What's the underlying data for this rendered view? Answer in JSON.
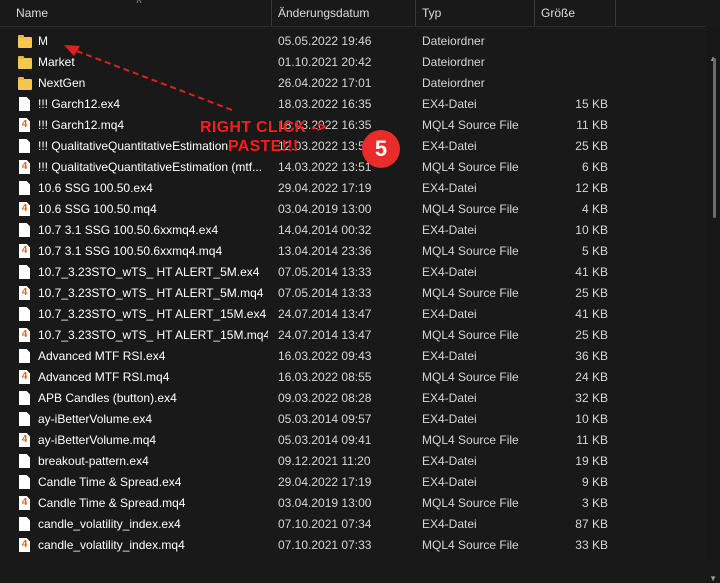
{
  "columns": {
    "name": "Name",
    "date": "Änderungsdatum",
    "type": "Typ",
    "size": "Größe"
  },
  "rows": [
    {
      "name": "M",
      "date": "05.05.2022 19:46",
      "type": "Dateiordner",
      "size": "",
      "icon": "folder"
    },
    {
      "name": "Market",
      "date": "01.10.2021 20:42",
      "type": "Dateiordner",
      "size": "",
      "icon": "folder"
    },
    {
      "name": "NextGen",
      "date": "26.04.2022 17:01",
      "type": "Dateiordner",
      "size": "",
      "icon": "folder"
    },
    {
      "name": "!!! Garch12.ex4",
      "date": "18.03.2022 16:35",
      "type": "EX4-Datei",
      "size": "15 KB",
      "icon": "file"
    },
    {
      "name": "!!! Garch12.mq4",
      "date": "18.03.2022 16:35",
      "type": "MQL4 Source File",
      "size": "11 KB",
      "icon": "mql"
    },
    {
      "name": "!!! QualitativeQuantitativeEstimation",
      "date": "12.03.2022 13:53",
      "type": "EX4-Datei",
      "size": "25 KB",
      "icon": "file"
    },
    {
      "name": "!!! QualitativeQuantitativeEstimation (mtf...",
      "date": "14.03.2022 13:51",
      "type": "MQL4 Source File",
      "size": "6 KB",
      "icon": "mql"
    },
    {
      "name": "10.6 SSG 100.50.ex4",
      "date": "29.04.2022 17:19",
      "type": "EX4-Datei",
      "size": "12 KB",
      "icon": "file"
    },
    {
      "name": "10.6 SSG 100.50.mq4",
      "date": "03.04.2019 13:00",
      "type": "MQL4 Source File",
      "size": "4 KB",
      "icon": "mql"
    },
    {
      "name": "10.7 3.1 SSG 100.50.6xxmq4.ex4",
      "date": "14.04.2014 00:32",
      "type": "EX4-Datei",
      "size": "10 KB",
      "icon": "file"
    },
    {
      "name": "10.7 3.1 SSG 100.50.6xxmq4.mq4",
      "date": "13.04.2014 23:36",
      "type": "MQL4 Source File",
      "size": "5 KB",
      "icon": "mql"
    },
    {
      "name": "10.7_3.23STO_wTS_ HT ALERT_5M.ex4",
      "date": "07.05.2014 13:33",
      "type": "EX4-Datei",
      "size": "41 KB",
      "icon": "file"
    },
    {
      "name": "10.7_3.23STO_wTS_ HT ALERT_5M.mq4",
      "date": "07.05.2014 13:33",
      "type": "MQL4 Source File",
      "size": "25 KB",
      "icon": "mql"
    },
    {
      "name": "10.7_3.23STO_wTS_ HT ALERT_15M.ex4",
      "date": "24.07.2014 13:47",
      "type": "EX4-Datei",
      "size": "41 KB",
      "icon": "file"
    },
    {
      "name": "10.7_3.23STO_wTS_ HT ALERT_15M.mq4",
      "date": "24.07.2014 13:47",
      "type": "MQL4 Source File",
      "size": "25 KB",
      "icon": "mql"
    },
    {
      "name": "Advanced MTF RSI.ex4",
      "date": "16.03.2022 09:43",
      "type": "EX4-Datei",
      "size": "36 KB",
      "icon": "file"
    },
    {
      "name": "Advanced MTF RSI.mq4",
      "date": "16.03.2022 08:55",
      "type": "MQL4 Source File",
      "size": "24 KB",
      "icon": "mql"
    },
    {
      "name": "APB Candles (button).ex4",
      "date": "09.03.2022 08:28",
      "type": "EX4-Datei",
      "size": "32 KB",
      "icon": "file"
    },
    {
      "name": "ay-iBetterVolume.ex4",
      "date": "05.03.2014 09:57",
      "type": "EX4-Datei",
      "size": "10 KB",
      "icon": "file"
    },
    {
      "name": "ay-iBetterVolume.mq4",
      "date": "05.03.2014 09:41",
      "type": "MQL4 Source File",
      "size": "11 KB",
      "icon": "mql"
    },
    {
      "name": "breakout-pattern.ex4",
      "date": "09.12.2021 11:20",
      "type": "EX4-Datei",
      "size": "19 KB",
      "icon": "file"
    },
    {
      "name": "Candle Time & Spread.ex4",
      "date": "29.04.2022 17:19",
      "type": "EX4-Datei",
      "size": "9 KB",
      "icon": "file"
    },
    {
      "name": "Candle Time & Spread.mq4",
      "date": "03.04.2019 13:00",
      "type": "MQL4 Source File",
      "size": "3 KB",
      "icon": "mql"
    },
    {
      "name": "candle_volatility_index.ex4",
      "date": "07.10.2021 07:34",
      "type": "EX4-Datei",
      "size": "87 KB",
      "icon": "file"
    },
    {
      "name": "candle_volatility_index.mq4",
      "date": "07.10.2021 07:33",
      "type": "MQL4 Source File",
      "size": "33 KB",
      "icon": "mql"
    }
  ],
  "annotation": {
    "line1": "RIGHT CLICK ->",
    "line2": "PASTE!!!",
    "step": "5",
    "color": "#ff1e1e"
  },
  "mql_icon_glyph": "4"
}
